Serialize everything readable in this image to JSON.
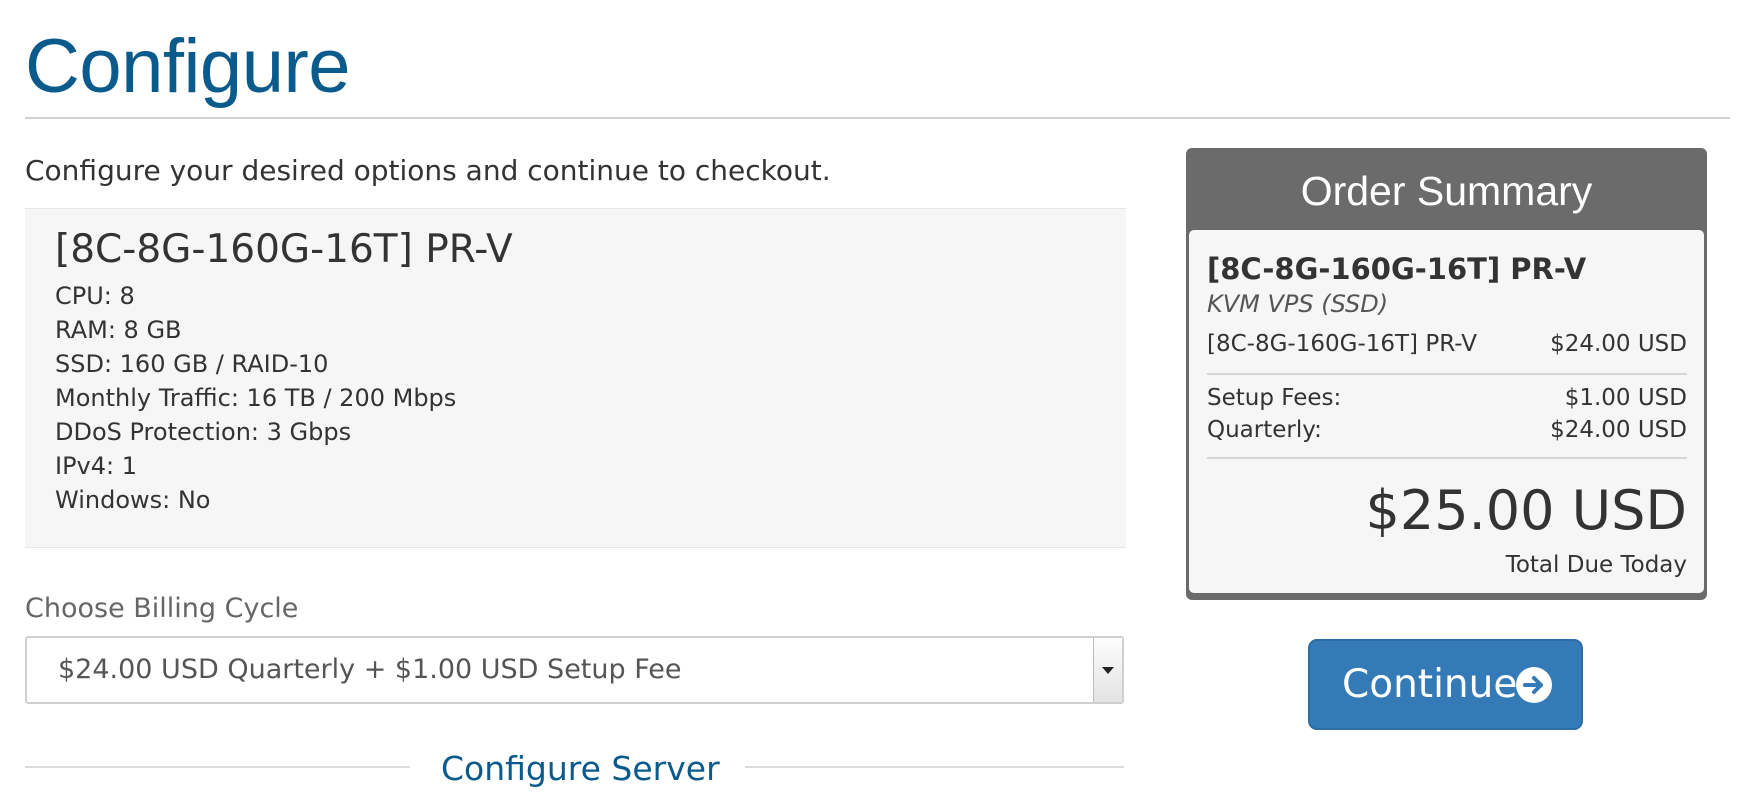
{
  "page": {
    "title": "Configure",
    "intro": "Configure your desired options and continue to checkout."
  },
  "product": {
    "name": "[8C-8G-160G-16T] PR-V",
    "features": [
      "CPU: 8",
      "RAM: 8 GB",
      "SSD: 160 GB / RAID-10",
      "Monthly Traffic: 16 TB / 200 Mbps",
      "DDoS Protection: 3 Gbps",
      "IPv4: 1",
      "Windows: No"
    ]
  },
  "billing": {
    "label": "Choose Billing Cycle",
    "selected": "$24.00 USD Quarterly + $1.00 USD Setup Fee"
  },
  "configure_server": {
    "title": "Configure Server"
  },
  "order_summary": {
    "title": "Order Summary",
    "product_name": "[8C-8G-160G-16T] PR-V",
    "product_group": "KVM VPS (SSD)",
    "line_item_label": "[8C-8G-160G-16T] PR-V",
    "line_item_price": "$24.00 USD",
    "setup_fees_label": "Setup Fees:",
    "setup_fees_value": "$1.00 USD",
    "recurring_label": "Quarterly:",
    "recurring_value": "$24.00 USD",
    "total": "$25.00 USD",
    "total_label": "Total Due Today"
  },
  "actions": {
    "continue_label": "Continue",
    "continue_icon": "arrow-circle-right-icon",
    "accent_color": "#337ab7"
  }
}
